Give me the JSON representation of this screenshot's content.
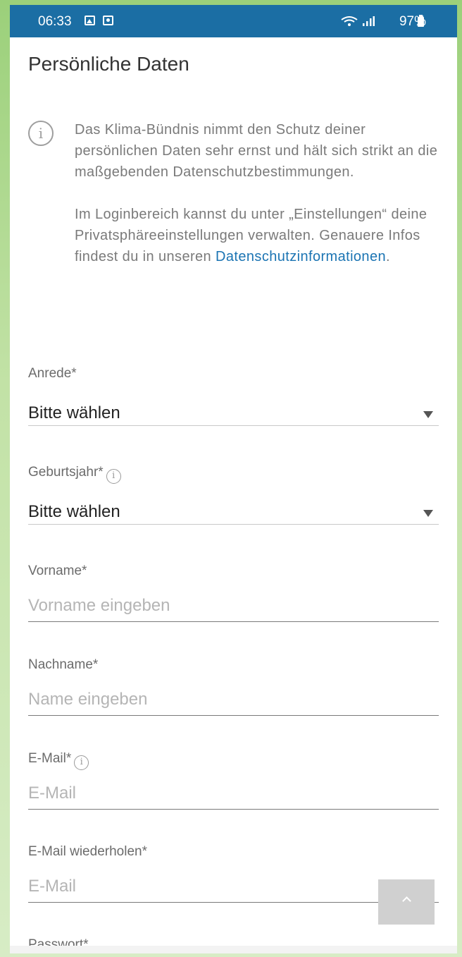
{
  "status_bar": {
    "time": "06:33",
    "battery": "97%",
    "icons": [
      "gallery-icon",
      "screenshot-icon",
      "wifi-icon",
      "signal-icon",
      "battery-icon"
    ]
  },
  "page": {
    "title": "Persönliche Daten"
  },
  "info": {
    "icon": "i",
    "paragraph1": "Das Klima-Bündnis nimmt den Schutz deiner persönlichen Daten sehr ernst und hält sich strikt an die maßgebenden Datenschutzbestimmungen.",
    "paragraph2_text": "Im Loginbereich kannst du unter „Einstellungen“ deine Privatsphäreeinstellungen verwalten. Genauere Infos findest du in unseren ",
    "link": "Datenschutzinformationen",
    "paragraph2_end": "."
  },
  "form": {
    "anrede": {
      "label": "Anrede*",
      "value": "Bitte wählen"
    },
    "geburtsjahr": {
      "label": "Geburtsjahr*",
      "value": "Bitte wählen",
      "info": "i"
    },
    "vorname": {
      "label": "Vorname*",
      "placeholder": "Vorname eingeben"
    },
    "nachname": {
      "label": "Nachname*",
      "placeholder": "Name eingeben"
    },
    "email": {
      "label": "E-Mail*",
      "placeholder": "E-Mail",
      "info": "i"
    },
    "email_repeat": {
      "label": "E-Mail wiederholen*",
      "placeholder": "E-Mail"
    },
    "passwort": {
      "label": "Passwort*"
    }
  },
  "colors": {
    "status_bar": "#1b6ea4",
    "link": "#1b74b3",
    "background_green": "#9bd07a"
  }
}
